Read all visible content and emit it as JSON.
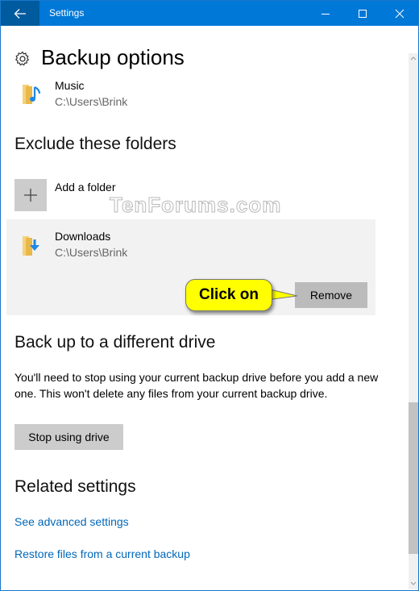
{
  "window": {
    "title": "Settings",
    "back_icon": "arrow-left-icon",
    "controls": [
      "minimize-icon",
      "maximize-icon",
      "close-icon"
    ]
  },
  "page": {
    "title": "Backup options",
    "title_icon": "gear-icon"
  },
  "included_folder": {
    "name": "Music",
    "path": "C:\\Users\\Brink",
    "icon": "music-folder-icon"
  },
  "exclude_section": {
    "heading": "Exclude these folders",
    "add_label": "Add a folder",
    "items": [
      {
        "name": "Downloads",
        "path": "C:\\Users\\Brink",
        "icon": "downloads-folder-icon",
        "selected": true,
        "remove_label": "Remove"
      }
    ]
  },
  "callout": {
    "text": "Click on"
  },
  "watermark": {
    "text": "TenForums.com"
  },
  "drive_section": {
    "heading": "Back up to a different drive",
    "description": "You'll need to stop using your current backup drive before you add a new one. This won't delete any files from your current backup drive.",
    "button_label": "Stop using drive"
  },
  "related_section": {
    "heading": "Related settings",
    "links": [
      "See advanced settings",
      "Restore files from a current backup"
    ]
  },
  "colors": {
    "accent": "#0078d7",
    "link": "#0067b8",
    "callout": "#ffff00"
  }
}
